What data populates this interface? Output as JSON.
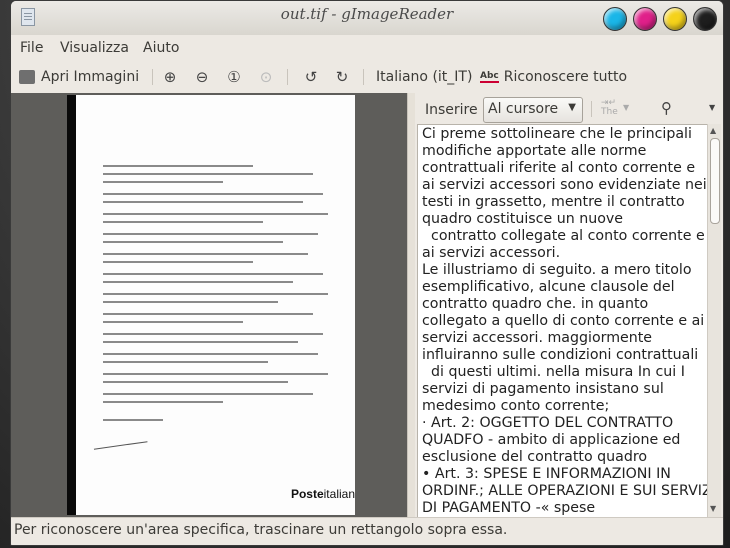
{
  "window": {
    "title": "out.tif - gImageReader"
  },
  "menubar": {
    "items": [
      "File",
      "Visualizza",
      "Aiuto"
    ]
  },
  "toolbar": {
    "open_label": "Apri Immagini",
    "language_label": "Italiano (it_IT)",
    "recognize_label": "Riconoscere tutto"
  },
  "document": {
    "logo_bold": "Poste",
    "logo_light": "italian"
  },
  "output_panel": {
    "insert_label": "Inserire",
    "insert_mode": "Al cursore",
    "text_lines": [
      "Ci preme sottolineare che le principali",
      "modifiche apportate alle norme",
      "contrattuali riferite al conto corrente e",
      "ai servizi accessori sono evidenziate nei",
      "testi in grassetto, mentre il contratto",
      "quadro costituisce un nuove",
      "  contratto collegate al conto corrente e",
      "ai servizi accessori.",
      "Le illustriamo di seguito. a mero titolo",
      "esemplificativo, alcune clausole del",
      "contratto quadro che. in quanto",
      "collegato a quello di conto corrente e ai",
      "servizi accessori. maggiormente",
      "influiranno sulle condizioni contrattuali",
      "  di questi ultimi. nella misura In cui I",
      "servizi di pagamento insistano sul",
      "medesimo conto corrente;",
      "· Art. 2: OGGETTO DEL CONTRATTO",
      "QUADFO - ambito di applicazione ed",
      "esclusione del contratto quadro",
      "• Art. 3: SPESE E INFORMAZIONI IN",
      "ORDINF.; ALLE OPERAZIONI E SUI SERVIZI",
      "DI PAGAMENTO -« spese"
    ]
  },
  "statusbar": {
    "text": "Per riconoscere un'area specifica, trascinare un rettangolo sopra essa."
  },
  "colors": {
    "close": "#1e1e1e",
    "yellow": "#f5d21a",
    "magenta": "#e0208a",
    "cyan": "#1ab6e8"
  }
}
